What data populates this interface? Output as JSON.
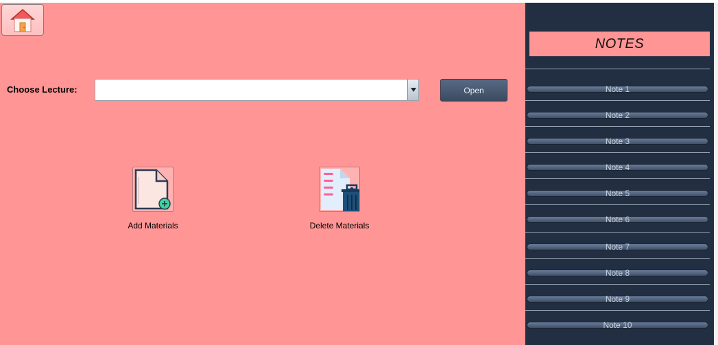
{
  "main": {
    "home_icon": "house-icon",
    "choose_lecture_label": "Choose Lecture:",
    "lecture_select_value": "",
    "open_label": "Open",
    "tiles": [
      {
        "label": "Add Materials",
        "icon": "add-document-icon"
      },
      {
        "label": "Delete Materials",
        "icon": "delete-document-icon"
      }
    ]
  },
  "sidebar": {
    "title": "NOTES",
    "notes": [
      "Note 1",
      "Note 2",
      "Note 3",
      "Note 4",
      "Note 5",
      "Note 6",
      "Note 7",
      "Note 8",
      "Note 9",
      "Note 10"
    ]
  },
  "colors": {
    "main_bg": "#ff9595",
    "sidebar_bg": "#222f42",
    "button_bg": "#4a5b75"
  }
}
